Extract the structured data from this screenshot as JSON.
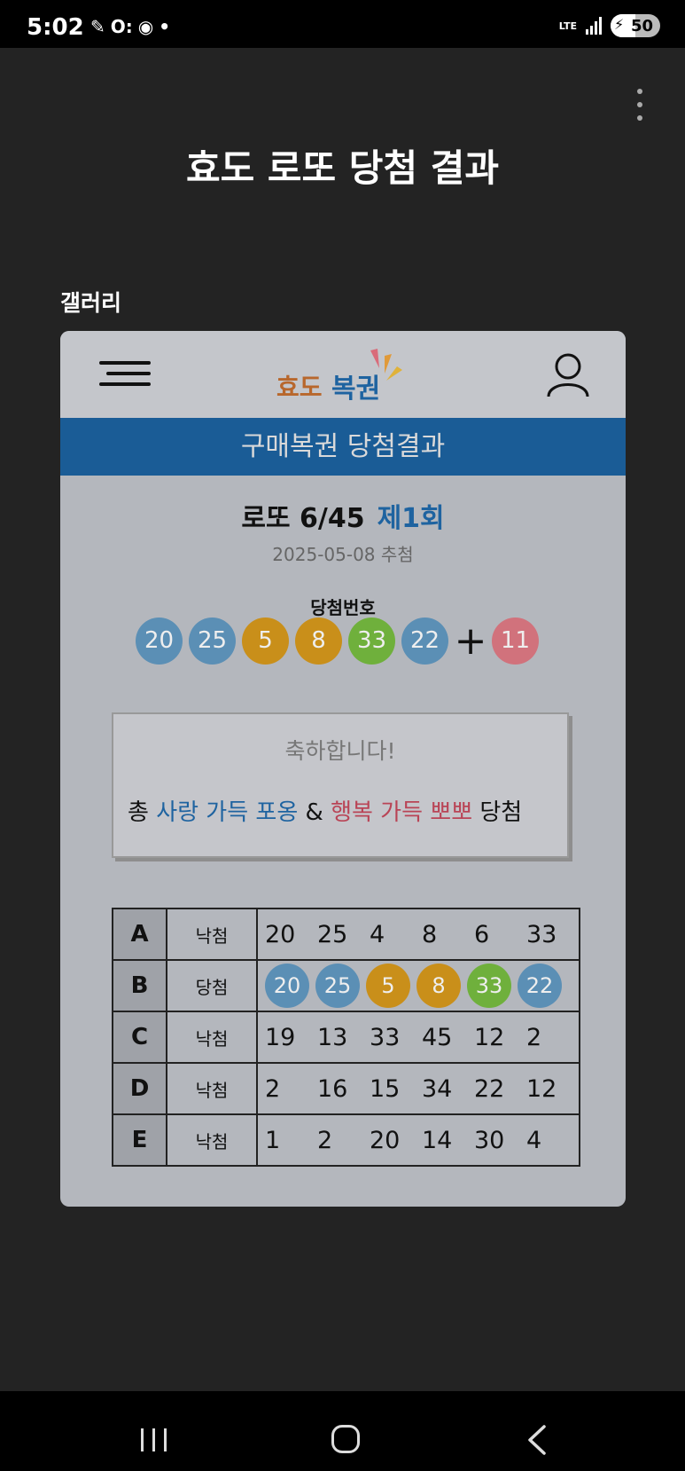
{
  "status_bar": {
    "time": "5:02",
    "network": "LTE",
    "battery": "50",
    "battery_level": 0.5
  },
  "app": {
    "title": "효도 로또 당첨 결과",
    "section_label": "갤러리"
  },
  "card": {
    "logo_part1": "효도",
    "logo_part2": "복권",
    "banner": "구매복권 당첨결과",
    "game": "로또 6/45",
    "round": "제1회",
    "date": "2025-05-08 추첨",
    "winning_label": "당첨번호",
    "winning_numbers": [
      {
        "n": "20",
        "color": "#5b8fb5"
      },
      {
        "n": "25",
        "color": "#5b8fb5"
      },
      {
        "n": "5",
        "color": "#c98f1a"
      },
      {
        "n": "8",
        "color": "#c98f1a"
      },
      {
        "n": "33",
        "color": "#6fb03c"
      },
      {
        "n": "22",
        "color": "#5b8fb5"
      }
    ],
    "plus": "+",
    "bonus": {
      "n": "11",
      "color": "#d1727c"
    },
    "congrats": {
      "line1": "축하합니다!",
      "prefix": "총",
      "prize1": "사랑 가득 포옹",
      "amp": "&",
      "prize2": "행복 가득 뽀뽀",
      "suffix": "당첨"
    },
    "results": [
      {
        "letter": "A",
        "result": "낙첨",
        "numbers": [
          "20",
          "25",
          "4",
          "8",
          "6",
          "33"
        ]
      },
      {
        "letter": "B",
        "result": "당첨",
        "numbers": [
          "20",
          "25",
          "5",
          "8",
          "33",
          "22"
        ]
      },
      {
        "letter": "C",
        "result": "낙첨",
        "numbers": [
          "19",
          "13",
          "33",
          "45",
          "12",
          "2"
        ]
      },
      {
        "letter": "D",
        "result": "낙첨",
        "numbers": [
          "2",
          "16",
          "15",
          "34",
          "22",
          "12"
        ]
      },
      {
        "letter": "E",
        "result": "낙첨",
        "numbers": [
          "1",
          "2",
          "20",
          "14",
          "30",
          "4"
        ]
      }
    ]
  }
}
